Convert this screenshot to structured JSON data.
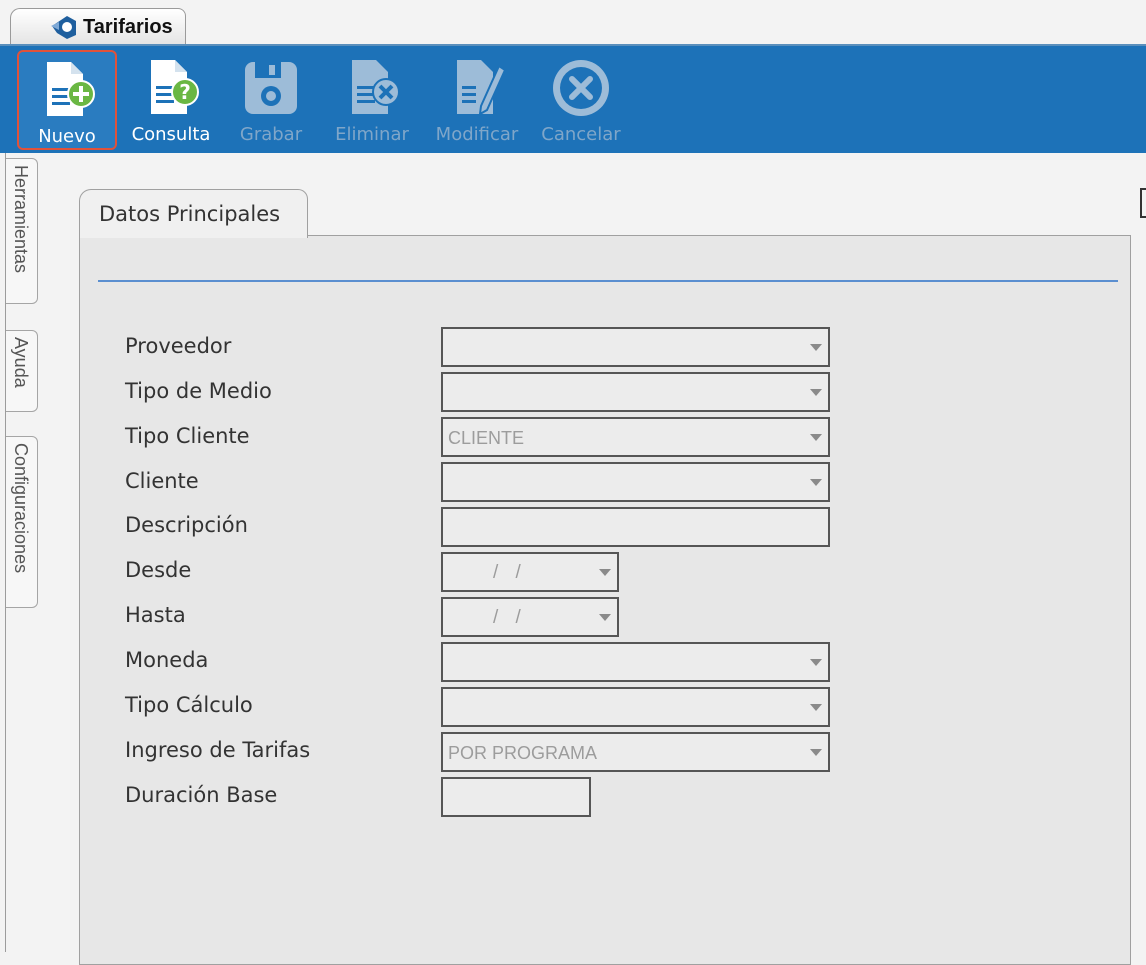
{
  "window_tab": {
    "title": "Tarifarios"
  },
  "toolbar": {
    "buttons": [
      {
        "label": "Nuevo",
        "icon": "document-add-icon",
        "state": "active"
      },
      {
        "label": "Consulta",
        "icon": "document-question-icon",
        "state": "enabled"
      },
      {
        "label": "Grabar",
        "icon": "save-disk-icon",
        "state": "disabled"
      },
      {
        "label": "Eliminar",
        "icon": "document-delete-icon",
        "state": "disabled"
      },
      {
        "label": "Modificar",
        "icon": "document-edit-icon",
        "state": "disabled"
      },
      {
        "label": "Cancelar",
        "icon": "cancel-circle-icon",
        "state": "disabled"
      }
    ]
  },
  "side_tabs": [
    "Herramientas",
    "Ayuda",
    "Configuraciones"
  ],
  "panel": {
    "tab_label": "Datos Principales"
  },
  "form": {
    "proveedor": {
      "label": "Proveedor",
      "value": ""
    },
    "tipo_medio": {
      "label": "Tipo de Medio",
      "value": ""
    },
    "tipo_cliente": {
      "label": "Tipo Cliente",
      "value": "CLIENTE"
    },
    "cliente": {
      "label": "Cliente",
      "value": ""
    },
    "descripcion": {
      "label": "Descripción",
      "value": ""
    },
    "desde": {
      "label": "Desde",
      "value": "/ /"
    },
    "hasta": {
      "label": "Hasta",
      "value": "/ /"
    },
    "moneda": {
      "label": "Moneda",
      "value": ""
    },
    "tipo_calculo": {
      "label": "Tipo Cálculo",
      "value": ""
    },
    "ingreso_tarifas": {
      "label": "Ingreso de Tarifas",
      "value": "POR PROGRAMA"
    },
    "duracion_base": {
      "label": "Duración Base",
      "value": ""
    }
  },
  "colors": {
    "toolbar_bg": "#1d72b8",
    "active_border": "#e0523a",
    "accent_line": "#5b8fd0"
  }
}
